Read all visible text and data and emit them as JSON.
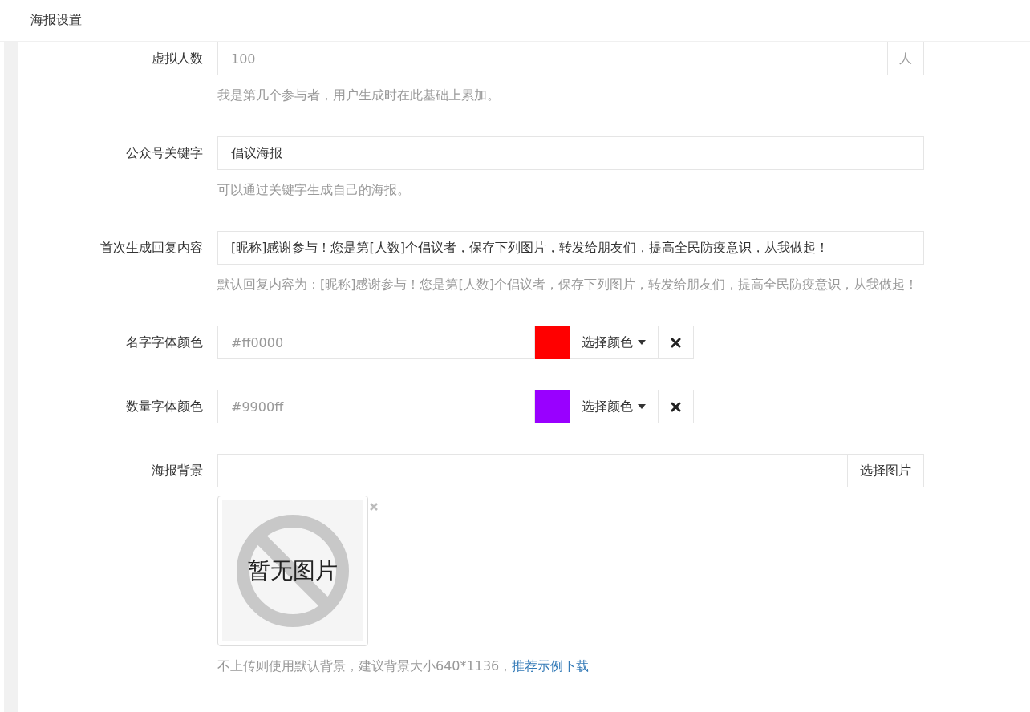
{
  "header": {
    "title": "海报设置"
  },
  "fields": [
    {
      "kind": "unit",
      "label": "虚拟人数",
      "placeholder": "100",
      "unit": "人",
      "help": "我是第几个参与者，用户生成时在此基础上累加。"
    },
    {
      "kind": "text",
      "label": "公众号关键字",
      "value": "倡议海报",
      "help": "可以通过关键字生成自己的海报。"
    },
    {
      "kind": "text",
      "label": "首次生成回复内容",
      "value": "[昵称]感谢参与！您是第[人数]个倡议者，保存下列图片，转发给朋友们，提高全民防疫意识，从我做起！",
      "help": "默认回复内容为：[昵称]感谢参与！您是第[人数]个倡议者，保存下列图片，转发给朋友们，提高全民防疫意识，从我做起！"
    },
    {
      "kind": "color",
      "label": "名字字体颜色",
      "placeholder": "#ff0000",
      "color": "#ff0000",
      "button": "选择颜色"
    },
    {
      "kind": "color",
      "label": "数量字体颜色",
      "placeholder": "#9900ff",
      "color": "#9900ff",
      "button": "选择颜色"
    },
    {
      "kind": "image",
      "label": "海报背景",
      "button": "选择图片",
      "image_text": "暂无图片",
      "help": "不上传则使用默认背景，建议背景大小640*1136，",
      "link": "推荐示例下载"
    }
  ]
}
